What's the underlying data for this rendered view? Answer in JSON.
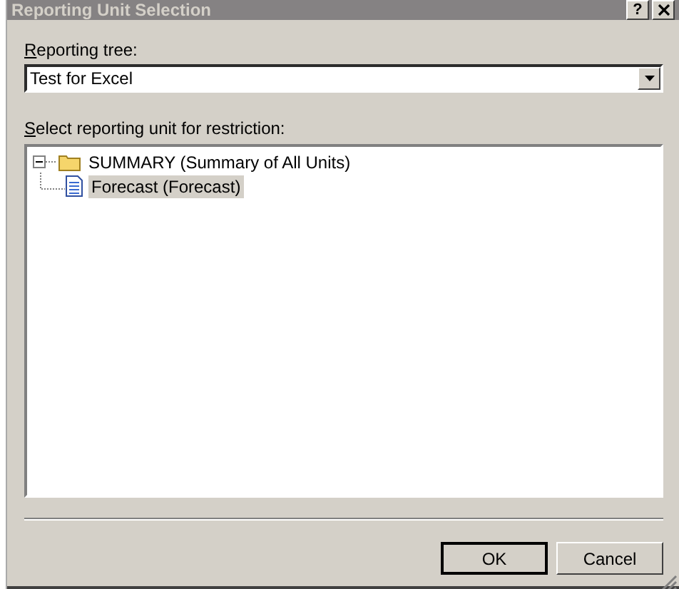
{
  "window": {
    "title": "Reporting Unit Selection",
    "buttons": [
      "?"
    ]
  },
  "reporting_tree": {
    "label": "Reporting tree:",
    "value": "Test for Excel"
  },
  "unit_tree": {
    "label": "Select reporting unit for restriction:",
    "items": [
      {
        "label": "SUMMARY (Summary of All Units)",
        "kind": "folder",
        "expanded": true,
        "selected": false,
        "children": [
          {
            "label": "Forecast (Forecast)",
            "kind": "document",
            "selected": true
          }
        ]
      }
    ]
  },
  "buttons": [
    {
      "label": "OK",
      "default": true
    },
    {
      "label": "Cancel",
      "default": false
    }
  ]
}
